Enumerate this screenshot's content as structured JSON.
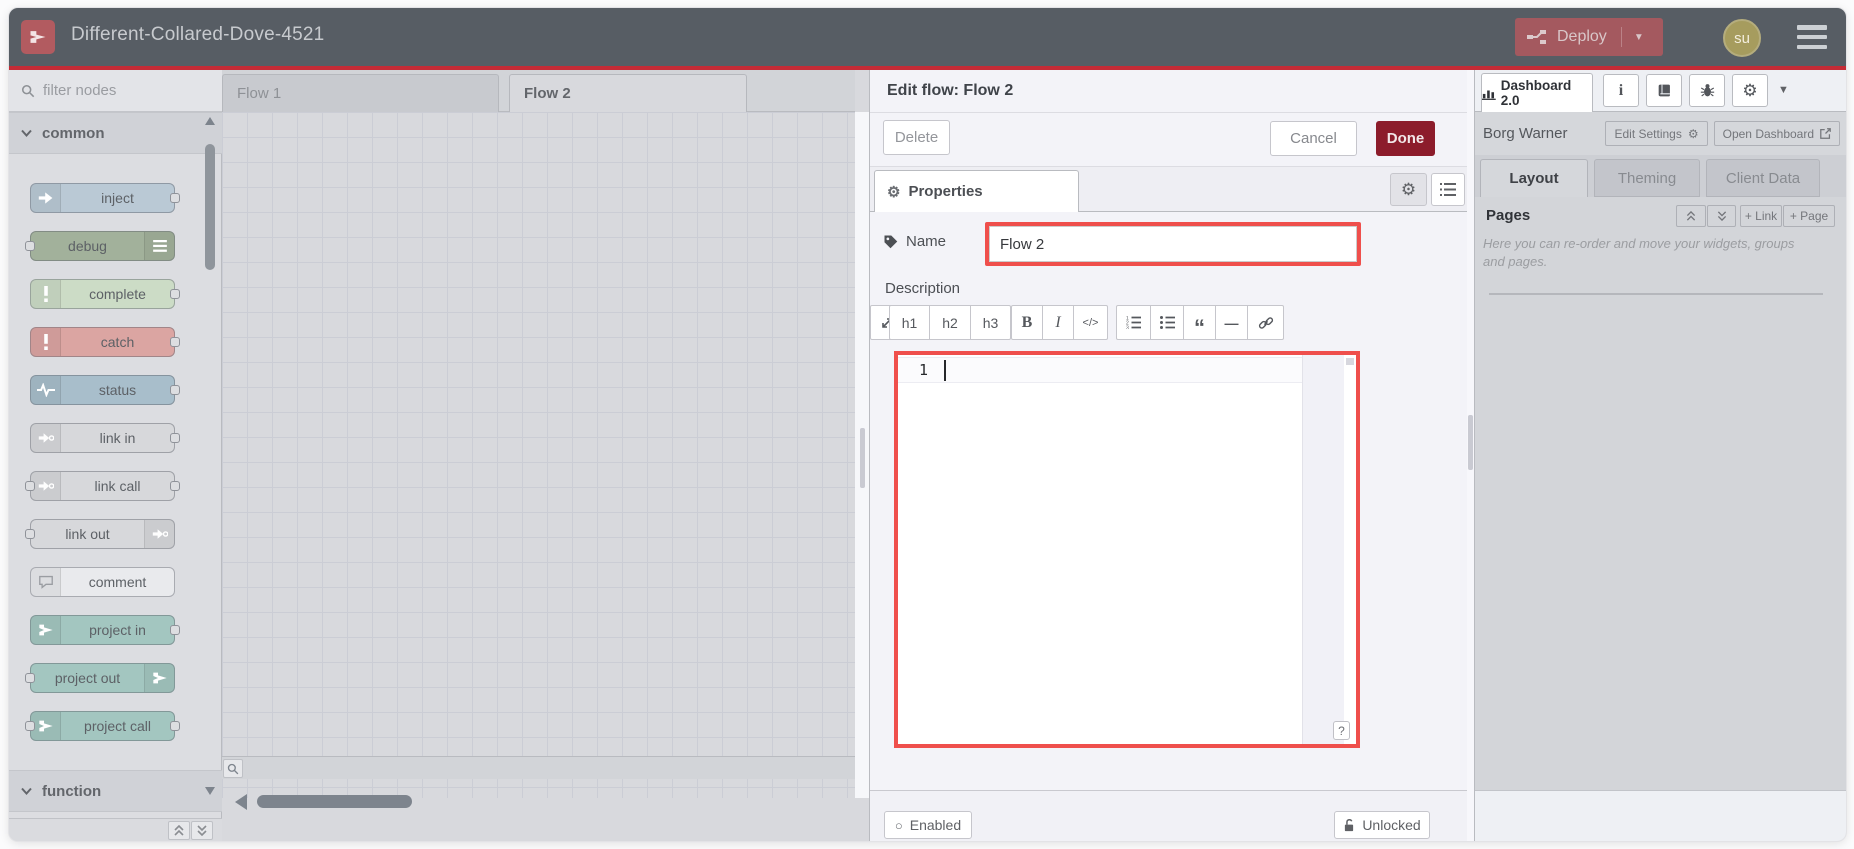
{
  "header": {
    "title": "Different-Collared-Dove-4521",
    "deploy_label": "Deploy",
    "avatar_initials": "su"
  },
  "palette": {
    "filter_placeholder": "filter nodes",
    "categories": [
      {
        "label": "common"
      },
      {
        "label": "function"
      }
    ],
    "nodes": [
      {
        "label": "inject",
        "color": "#bac9d5",
        "icon": "inject-arrow",
        "iconSide": "left",
        "ports": "right"
      },
      {
        "label": "debug",
        "color": "#a2b19b",
        "icon": "debug-list",
        "iconSide": "right",
        "ports": "left"
      },
      {
        "label": "complete",
        "color": "#ccdcc6",
        "icon": "exclamation",
        "iconSide": "left",
        "ports": "right"
      },
      {
        "label": "catch",
        "color": "#dba5a2",
        "icon": "exclamation",
        "iconSide": "left",
        "ports": "right"
      },
      {
        "label": "status",
        "color": "#a8becb",
        "icon": "pulse",
        "iconSide": "left",
        "ports": "right"
      },
      {
        "label": "link in",
        "color": "#d7d8db",
        "icon": "link-node",
        "iconSide": "left",
        "ports": "right"
      },
      {
        "label": "link call",
        "color": "#d7d8db",
        "icon": "link-node",
        "iconSide": "left",
        "ports": "both"
      },
      {
        "label": "link out",
        "color": "#d7d8db",
        "icon": "link-node",
        "iconSide": "right",
        "ports": "left"
      },
      {
        "label": "comment",
        "color": "#e9eaed",
        "icon": "comment-bubble",
        "iconSide": "left",
        "ports": "none"
      },
      {
        "label": "project in",
        "color": "#a3c6c0",
        "icon": "node-red-logo",
        "iconSide": "left",
        "ports": "right"
      },
      {
        "label": "project out",
        "color": "#a3c6c0",
        "icon": "node-red-logo",
        "iconSide": "right",
        "ports": "left"
      },
      {
        "label": "project call",
        "color": "#a3c6c0",
        "icon": "node-red-logo",
        "iconSide": "left",
        "ports": "both"
      }
    ]
  },
  "workspace": {
    "tabs": [
      {
        "label": "Flow 1",
        "active": false
      },
      {
        "label": "Flow 2",
        "active": true
      }
    ]
  },
  "dialog": {
    "title": "Edit flow: Flow 2",
    "delete_label": "Delete",
    "cancel_label": "Cancel",
    "done_label": "Done",
    "properties_tab_label": "Properties",
    "name_label": "Name",
    "name_value": "Flow 2",
    "description_label": "Description",
    "toolbar": {
      "h1": "h1",
      "h2": "h2",
      "h3": "h3",
      "bold": "B",
      "italic": "I",
      "code": "</>",
      "quote": "“",
      "hr": "—"
    },
    "editor": {
      "line_number": "1"
    },
    "help_button_label": "?",
    "footer": {
      "enabled_label": "Enabled",
      "unlocked_label": "Unlocked"
    }
  },
  "sidebar": {
    "dashboard_tab_label": "Dashboard 2.0",
    "project_name": "Borg Warner",
    "edit_settings_label": "Edit Settings",
    "open_dashboard_label": "Open Dashboard",
    "tabs": [
      {
        "label": "Layout",
        "active": true
      },
      {
        "label": "Theming",
        "active": false
      },
      {
        "label": "Client Data",
        "active": false
      }
    ],
    "pages_title": "Pages",
    "add_link_label": "+ Link",
    "add_page_label": "+ Page",
    "help_text": "Here you can re-order and move your widgets, groups and pages."
  },
  "icons": {
    "gear": "⚙",
    "chevron-down": "▼",
    "circle": "○",
    "info": "i"
  },
  "colors": {
    "header_bg": "#575d64",
    "accent_red_line": "#c52b36",
    "highlight_red": "#ef4f4c",
    "done_red": "#8c1c2b",
    "deploy_red": "#a4595f",
    "avatar_olive": "#a69c5e",
    "canvas_gray": "#d8d9dd"
  }
}
